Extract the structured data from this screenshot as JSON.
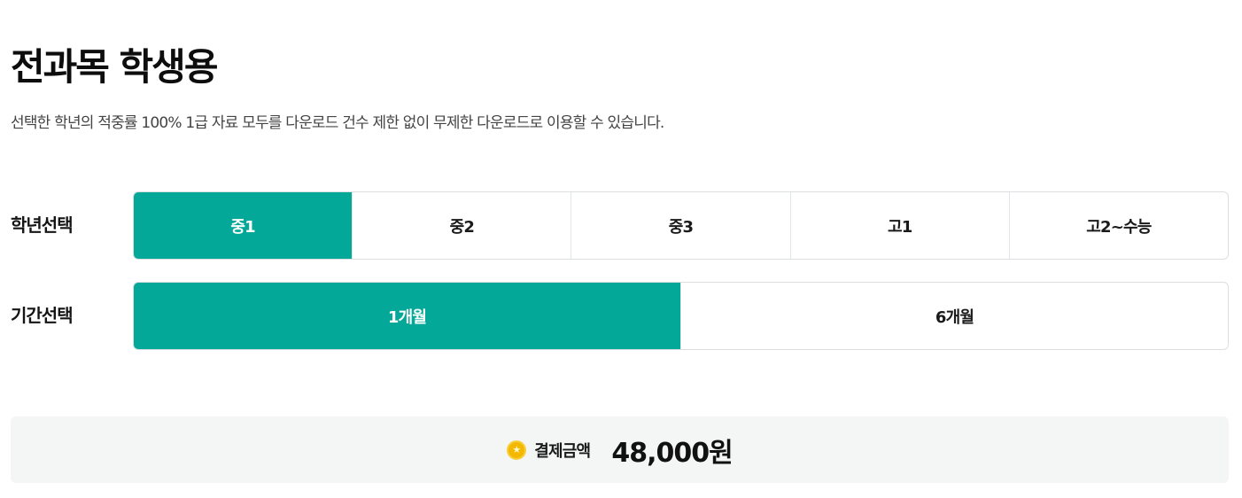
{
  "header": {
    "title": "전과목 학생용",
    "description": "선택한 학년의 적중률 100% 1급 자료 모두를 다운로드 건수 제한 없이 무제한 다운로드로 이용할 수 있습니다."
  },
  "grade_select": {
    "label": "학년선택",
    "options": [
      "중1",
      "중2",
      "중3",
      "고1",
      "고2~수능"
    ],
    "selected": "중1"
  },
  "period_select": {
    "label": "기간선택",
    "options": [
      "1개월",
      "6개월"
    ],
    "selected": "1개월"
  },
  "payment": {
    "icon": "coin-icon",
    "label": "결제금액",
    "amount": "48,000원"
  },
  "colors": {
    "accent": "#04a899",
    "coin": "#f5b800",
    "payment_bg": "#f4f5f5"
  }
}
